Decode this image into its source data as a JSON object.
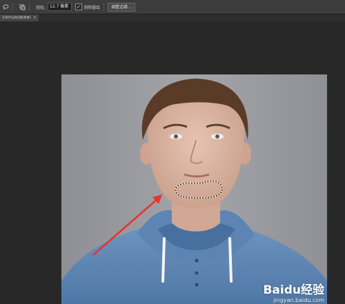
{
  "toolbar": {
    "tool_icon": "lasso-tool-icon",
    "selection_mode_icon": "new-selection-icon",
    "feather_label": "羽化:",
    "feather_value": "12.7 像素",
    "anti_alias_checked": true,
    "anti_alias_label": "消除锯齿",
    "refine_edge_label": "调整边缘..."
  },
  "document_tab": {
    "label": "100%(RGB/8#)",
    "close_label": "×"
  },
  "canvas": {
    "background_color": "#282828",
    "selection_shape": "marching-ants-chin",
    "annotation_arrow_color": "#e8332a"
  },
  "watermark": {
    "brand": "Baidu经验",
    "url": "jingyan.baidu.com"
  }
}
